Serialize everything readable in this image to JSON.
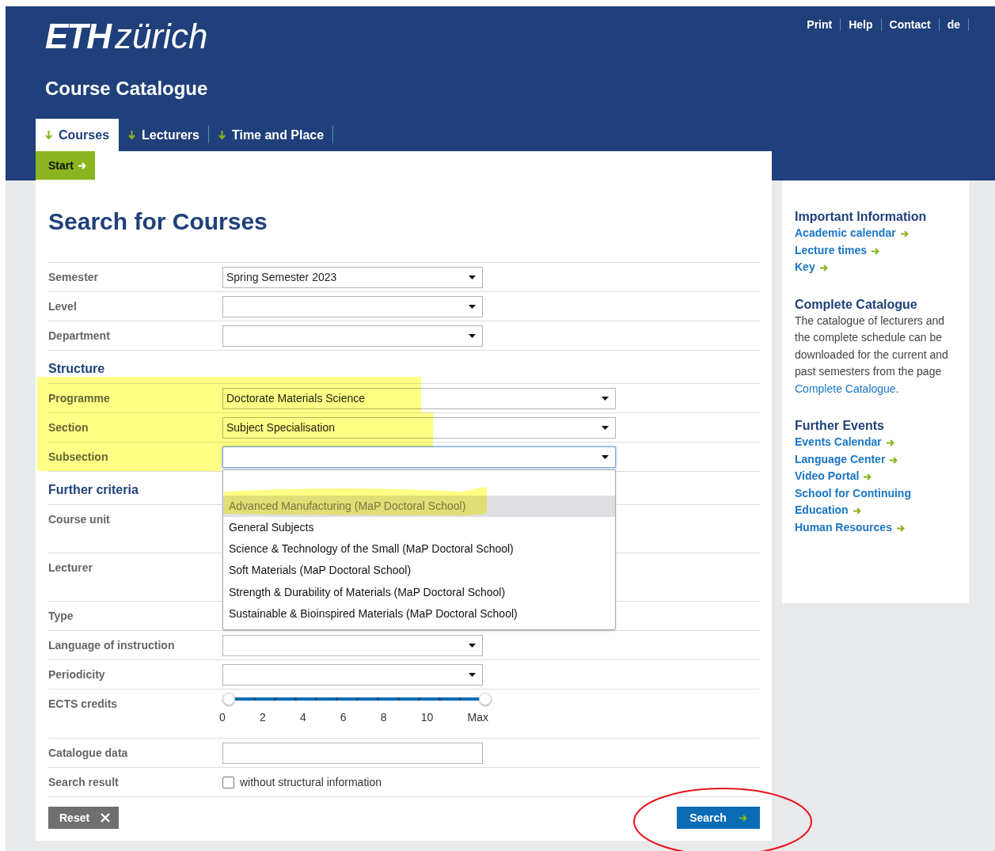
{
  "top_links": [
    "Print",
    "Help",
    "Contact",
    "de"
  ],
  "logo": {
    "bold": "ETH",
    "light": "zürich"
  },
  "site_title": "Course Catalogue",
  "tabs": [
    {
      "label": "Courses",
      "selected": true
    },
    {
      "label": "Lecturers",
      "selected": false
    },
    {
      "label": "Time and Place",
      "selected": false
    }
  ],
  "start_button": "Start",
  "heading": "Search for Courses",
  "form_rows": [
    {
      "kind": "select",
      "label": "Semester",
      "value": "Spring Semester 2023"
    },
    {
      "kind": "select",
      "label": "Level"
    },
    {
      "kind": "select",
      "label": "Department"
    },
    {
      "kind": "heading",
      "label": "Structure"
    },
    {
      "kind": "wide_select",
      "label": "Programme",
      "value": "Doctorate Materials Science"
    },
    {
      "kind": "wide_select",
      "label": "Section",
      "value": "Subject Specialisation"
    },
    {
      "kind": "wide_select",
      "label": "Subsection",
      "focused": true,
      "open": true
    },
    {
      "kind": "heading",
      "label": "Further criteria"
    },
    {
      "kind": "covered_tall",
      "label": "Course unit"
    },
    {
      "kind": "covered_tall",
      "label": "Lecturer"
    },
    {
      "kind": "covered",
      "label": "Type"
    },
    {
      "kind": "select",
      "label": "Language of instruction"
    },
    {
      "kind": "select",
      "label": "Periodicity"
    },
    {
      "kind": "slider",
      "label": "ECTS credits",
      "level": 1,
      "ticks": [
        "0",
        "2",
        "4",
        "6",
        "8",
        "10",
        "Max"
      ]
    },
    {
      "kind": "text",
      "label": "Catalogue data"
    },
    {
      "kind": "checkbox",
      "label": "Search result",
      "text": "without structural information",
      "checked": false
    }
  ],
  "dropdown_options": [
    {
      "label": "Advanced Manufacturing (MaP Doctoral School)",
      "selected": true
    },
    {
      "label": "General Subjects",
      "selected": false
    },
    {
      "label": "Science & Technology of the Small (MaP Doctoral School)",
      "selected": false
    },
    {
      "label": "Soft Materials (MaP Doctoral School)",
      "selected": false
    },
    {
      "label": "Strength & Durability of Materials (MaP Doctoral School)",
      "selected": false
    },
    {
      "label": "Sustainable & Bioinspired Materials (MaP Doctoral School)",
      "selected": false
    }
  ],
  "reset_button": "Reset",
  "search_button": "Search",
  "sidebar": [
    {
      "title": "Important Information",
      "links": [
        "Academic calendar",
        "Lecture times",
        "Key"
      ]
    },
    {
      "title": "Complete Catalogue",
      "text": "The catalogue of lecturers and the complete schedule can be downloaded for the current and past semesters from the page ",
      "link": "Complete Catalogue",
      "text_after": "."
    },
    {
      "title": "Further Events",
      "links": [
        "Events Calendar",
        "Language Center",
        "Video Portal",
        "School for Continuing Education",
        "Human Resources"
      ]
    }
  ]
}
